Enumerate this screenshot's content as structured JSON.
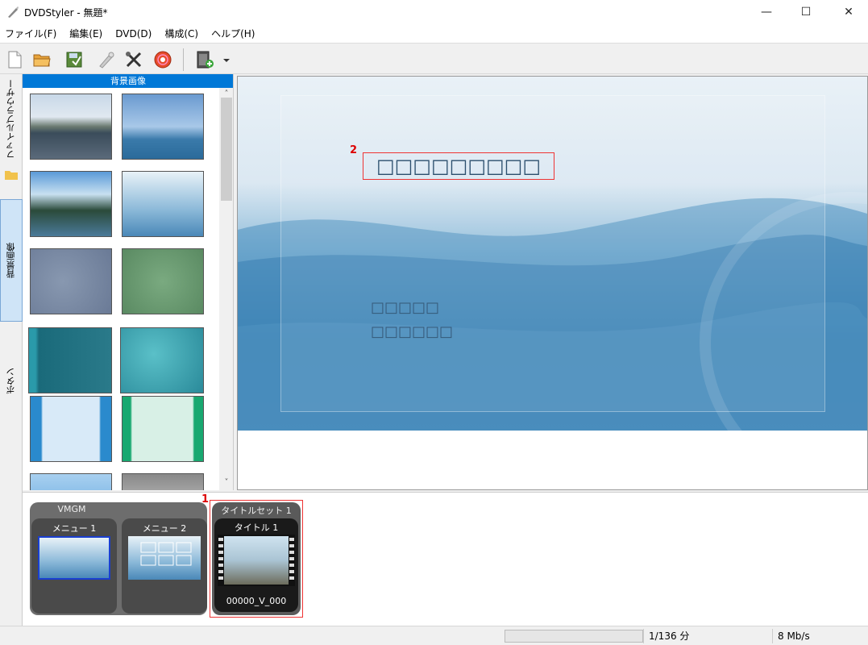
{
  "window": {
    "title": "DVDStyler - 無題*",
    "controls": {
      "minimize": "—",
      "maximize": "☐",
      "close": "✕"
    }
  },
  "menubar": {
    "items": [
      "ファイル(F)",
      "編集(E)",
      "DVD(D)",
      "構成(C)",
      "ヘルプ(H)"
    ]
  },
  "toolbar": {
    "buttons": [
      "new-icon",
      "open-icon",
      "save-icon",
      "edit-icon",
      "settings-icon",
      "burn-icon",
      "add-file-icon",
      "dropdown-arrow-icon"
    ]
  },
  "sidetabs": {
    "file_browser": "ファイルブラウザー",
    "backgrounds": "背景画像",
    "buttons": "ボタン"
  },
  "panel": {
    "header": "背景画像",
    "scroll_up": "˄",
    "scroll_down": "˅"
  },
  "preview": {
    "title_text": "□□□□□□□□□",
    "menu_item_1": "□□□□□",
    "menu_item_2": "□□□□□□",
    "callout_2": "2"
  },
  "titleset_bar": {
    "vmgm_label": "VMGM",
    "menu1_label": "メニュー 1",
    "menu2_label": "メニュー 2",
    "titleset_label": "タイトルセット 1",
    "title1_label": "タイトル 1",
    "title1_file": "00000_V_000",
    "callout_1": "1"
  },
  "statusbar": {
    "progress": 0,
    "duration": "1/136 分",
    "bitrate": "8 Mb/s"
  }
}
